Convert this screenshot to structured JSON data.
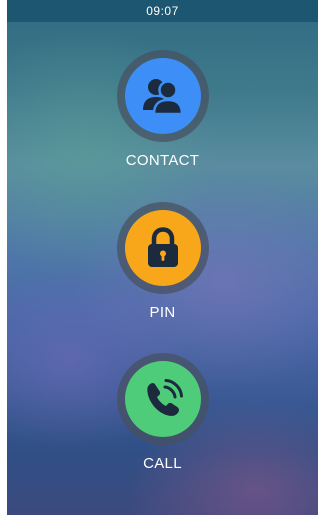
{
  "status_bar": {
    "time": "09:07"
  },
  "actions": [
    {
      "label": "CONTACT",
      "icon": "contacts-icon",
      "color": "#3d8ff7"
    },
    {
      "label": "PIN",
      "icon": "lock-icon",
      "color": "#f8a71b"
    },
    {
      "label": "CALL",
      "icon": "phone-call-icon",
      "color": "#4fcc7a"
    }
  ]
}
